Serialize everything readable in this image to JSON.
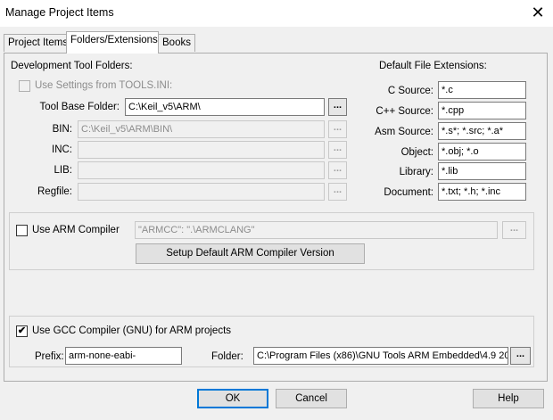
{
  "window": {
    "title": "Manage Project Items",
    "close_symbol": "✕"
  },
  "tabs": [
    "Project Items",
    "Folders/Extensions",
    "Books"
  ],
  "tool_folders": {
    "heading": "Development Tool Folders:",
    "use_settings_label": "Use Settings from TOOLS.INI:",
    "tool_base_label": "Tool Base Folder:",
    "tool_base_value": "C:\\Keil_v5\\ARM\\",
    "bin_label": "BIN:",
    "bin_value": "C:\\Keil_v5\\ARM\\BIN\\",
    "inc_label": "INC:",
    "inc_value": "",
    "lib_label": "LIB:",
    "lib_value": "",
    "regfile_label": "Regfile:",
    "regfile_value": "",
    "browse_label": "..."
  },
  "extensions": {
    "heading": "Default File Extensions:",
    "c_label": "C Source:",
    "c_value": "*.c",
    "cpp_label": "C++ Source:",
    "cpp_value": "*.cpp",
    "asm_label": "Asm Source:",
    "asm_value": "*.s*; *.src; *.a*",
    "obj_label": "Object:",
    "obj_value": "*.obj; *.o",
    "lib_label": "Library:",
    "lib_value": "*.lib",
    "doc_label": "Document:",
    "doc_value": "*.txt; *.h; *.inc"
  },
  "arm": {
    "use_label": "Use ARM Compiler",
    "checked": false,
    "path_value": "\"ARMCC\": \".\\ARMCLANG\"",
    "setup_button": "Setup Default ARM Compiler Version"
  },
  "gcc": {
    "use_label": "Use GCC Compiler (GNU) for ARM projects",
    "checked": true,
    "check_mark": "✔",
    "prefix_label": "Prefix:",
    "prefix_value": "arm-none-eabi-",
    "folder_label": "Folder:",
    "folder_value": "C:\\Program Files (x86)\\GNU Tools ARM Embedded\\4.9 20"
  },
  "buttons": {
    "ok": "OK",
    "cancel": "Cancel",
    "help": "Help"
  }
}
